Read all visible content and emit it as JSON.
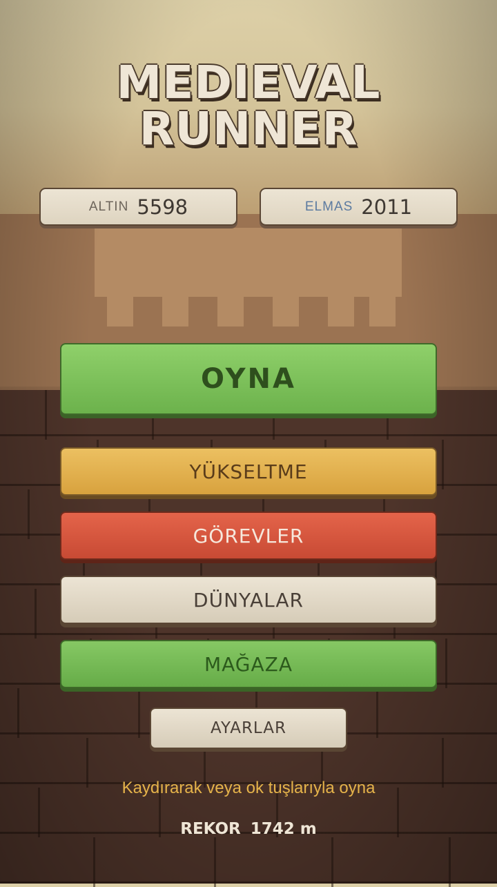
{
  "title": {
    "line1": "MEDIEVAL",
    "line2": "RUNNER"
  },
  "stats": {
    "gold": {
      "label": "ALTIN",
      "value": "5598"
    },
    "gems": {
      "label": "ELMAS",
      "value": "2011"
    }
  },
  "menu": {
    "play": "OYNA",
    "upgrade": "YÜKSELTME",
    "missions": "GÖREVLER",
    "worlds": "DÜNYALAR",
    "shop": "MAĞAZA",
    "settings": "AYARLAR"
  },
  "hint": "Kaydırarak veya ok tuşlarıyla oyna",
  "record": {
    "label": "REKOR",
    "value": "1742 m"
  },
  "colors": {
    "play": "#7cc25a",
    "upgrade": "#e3b04f",
    "missions": "#d5563e",
    "neutral": "#e2d9c6",
    "shop": "#76ba56",
    "hint": "#e5b34a"
  }
}
